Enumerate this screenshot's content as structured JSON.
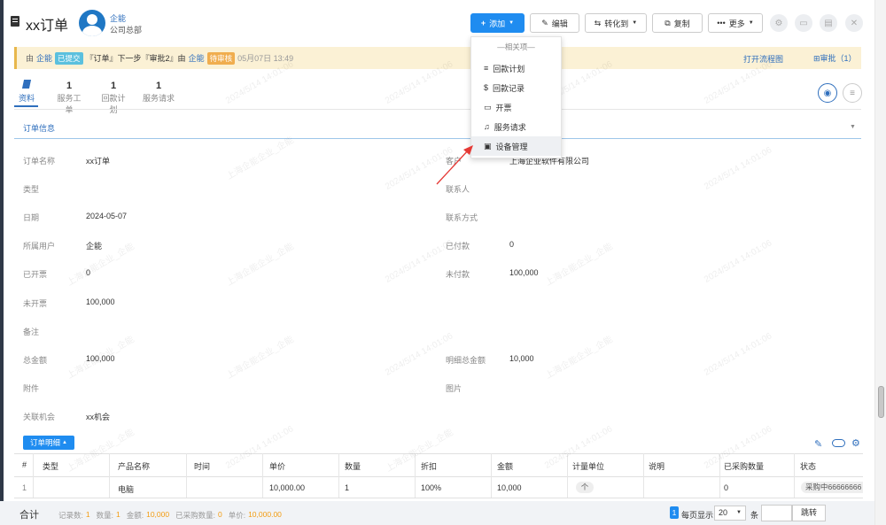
{
  "header": {
    "title": "xx订单",
    "user_name": "企能",
    "org": "公司总部"
  },
  "toolbar": {
    "add": "添加",
    "edit": "编辑",
    "convert": "转化到",
    "copy": "复制",
    "more": "更多"
  },
  "flow": {
    "by_prefix": "由",
    "by_user": "企能",
    "status_submitted": "已提交",
    "segment": "『订单』下一步『审批2』由",
    "next_user": "企能",
    "status_pending": "待审核",
    "time": "05月07日 13:49",
    "open_flow": "打开流程图",
    "approval": "审批（1）"
  },
  "tabs": [
    {
      "count": "",
      "label": "资料"
    },
    {
      "count": "1",
      "label": "服务工单"
    },
    {
      "count": "1",
      "label": "回款计划"
    },
    {
      "count": "1",
      "label": "服务请求"
    }
  ],
  "section_title": "订单信息",
  "fields_left": [
    {
      "label": "订单名称",
      "value": "xx订单",
      "link": false
    },
    {
      "label": "类型",
      "value": "",
      "link": false
    },
    {
      "label": "日期",
      "value": "2024-05-07",
      "link": false
    },
    {
      "label": "所属用户",
      "value": "企能",
      "link": true
    },
    {
      "label": "已开票",
      "value": "0",
      "link": false
    },
    {
      "label": "未开票",
      "value": "100,000",
      "link": false
    },
    {
      "label": "备注",
      "value": "",
      "link": false
    },
    {
      "label": "总金额",
      "value": "100,000",
      "link": false
    },
    {
      "label": "附件",
      "value": "",
      "link": false
    },
    {
      "label": "关联机会",
      "value": "xx机会",
      "link": true
    }
  ],
  "fields_right": [
    {
      "label": "客户",
      "value": "上海企业软件有限公司",
      "link": true
    },
    {
      "label": "联系人",
      "value": "",
      "link": false
    },
    {
      "label": "联系方式",
      "value": "",
      "link": false
    },
    {
      "label": "已付款",
      "value": "0",
      "link": false
    },
    {
      "label": "未付款",
      "value": "100,000",
      "link": false
    },
    {
      "label": "",
      "value": "",
      "link": false
    },
    {
      "label": "",
      "value": "",
      "link": false
    },
    {
      "label": "明细总金额",
      "value": "10,000",
      "link": false
    },
    {
      "label": "图片",
      "value": "",
      "link": false
    },
    {
      "label": "",
      "value": "",
      "link": false
    }
  ],
  "dropdown": {
    "header": "—相关项—",
    "items": [
      "回款计划",
      "回款记录",
      "开票",
      "服务请求",
      "设备管理"
    ],
    "icons": [
      "list-icon",
      "dollar-icon",
      "card-icon",
      "headset-icon",
      "device-icon"
    ]
  },
  "detail_tab": "订单明细",
  "table": {
    "headers": [
      "#",
      "类型",
      "产品名称",
      "时间",
      "单价",
      "数量",
      "折扣",
      "金额",
      "计量单位",
      "说明",
      "已采购数量",
      "状态"
    ],
    "row": [
      "1",
      "",
      "电脑",
      "",
      "10,000.00",
      "1",
      "100%",
      "10,000",
      "个",
      "",
      "0",
      "采购中66666666"
    ]
  },
  "footer": {
    "total_label": "合计",
    "record_label": "记录数:",
    "record_count": "1",
    "qty_label": "数量:",
    "qty": "1",
    "amount_label": "金额:",
    "amount": "10,000",
    "purchased_label": "已采购数量:",
    "purchased": "0",
    "price_label": "单价:",
    "price": "10,000.00",
    "page": "1",
    "per_page_label": "每页显示",
    "per_page": "20",
    "unit": "条",
    "jump": "跳转"
  },
  "watermark": "2024/5/14 14:01:06",
  "watermark2": "上海企能企业_企能",
  "colors": {
    "primary": "#1f8cf0",
    "link": "#2f6fbd",
    "flow_bg": "#fbf1d5",
    "pending": "#f0ad4e",
    "submitted": "#5bc0de",
    "orange": "#f39c12"
  }
}
